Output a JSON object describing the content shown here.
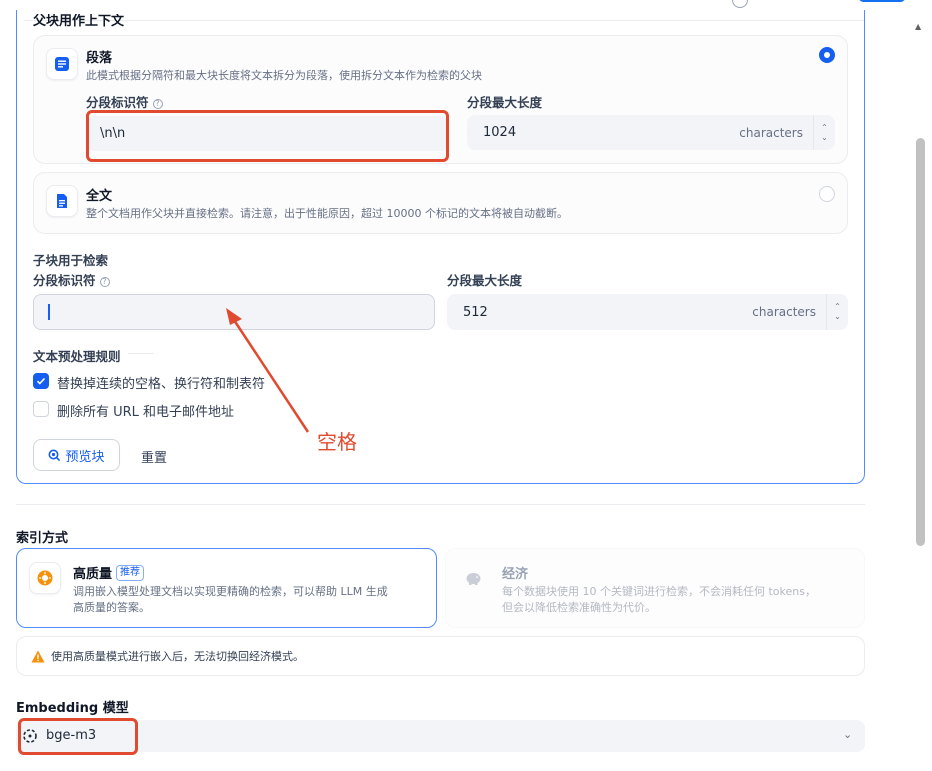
{
  "parent_section": {
    "title": "父块用作上下文",
    "paragraph": {
      "title": "段落",
      "desc": "此模式根据分隔符和最大块长度将文本拆分为段落，使用拆分文本作为检索的父块",
      "separator_label": "分段标识符",
      "separator_value": "\\n\\n",
      "maxlen_label": "分段最大长度",
      "maxlen_value": "1024",
      "unit": "characters",
      "selected": true
    },
    "fulltext": {
      "title": "全文",
      "desc": "整个文档用作父块并直接检索。请注意，出于性能原因，超过 10000 个标记的文本将被自动截断。",
      "selected": false
    }
  },
  "child_section": {
    "title": "子块用于检索",
    "separator_label": "分段标识符",
    "separator_value": "",
    "maxlen_label": "分段最大长度",
    "maxlen_value": "512",
    "unit": "characters"
  },
  "preprocess": {
    "title": "文本预处理规则",
    "rules": [
      {
        "label": "替换掉连续的空格、换行符和制表符",
        "checked": true
      },
      {
        "label": "删除所有 URL 和电子邮件地址",
        "checked": false
      }
    ]
  },
  "buttons": {
    "preview": "预览块",
    "reset": "重置"
  },
  "annotation": {
    "text": "空格",
    "color": "#e04a2f"
  },
  "index_section": {
    "title": "索引方式",
    "high_quality": {
      "title": "高质量",
      "badge": "推荐",
      "desc_line1": "调用嵌入模型处理文档以实现更精确的检索，可以帮助 LLM 生成",
      "desc_line2": "高质量的答案。"
    },
    "economy": {
      "title": "经济",
      "desc_line1": "每个数据块使用 10 个关键词进行检索，不会消耗任何 tokens，",
      "desc_line2": "但会以降低检索准确性为代价。"
    },
    "warning": "使用高质量模式进行嵌入后，无法切换回经济模式。"
  },
  "embedding": {
    "title": "Embedding 模型",
    "value": "bge-m3"
  },
  "colors": {
    "accent": "#155eef",
    "border_active": "#528bff",
    "annotation": "#e04a2f",
    "warning": "#f79009"
  }
}
